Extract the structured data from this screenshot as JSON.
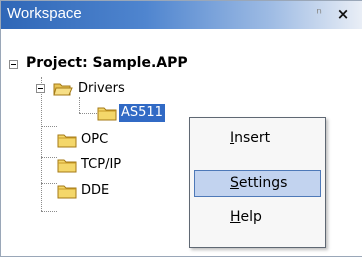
{
  "window": {
    "title": "Workspace",
    "pin_icon": "pin-icon",
    "close_icon": "close-icon",
    "title_color": "#2f67b7"
  },
  "tree": {
    "project_label": "Project: Sample.APP",
    "drivers_label": "Drivers",
    "driver_child_label": "AS511",
    "items": [
      "OPC",
      "TCP/IP",
      "DDE"
    ],
    "folder_color": "#f4d76a",
    "selection_color": "#316ac5"
  },
  "context_menu": {
    "items": [
      {
        "label": "Insert",
        "mnemonic": "I"
      },
      {
        "label": "Settings",
        "mnemonic": "S"
      },
      {
        "label": "Help",
        "mnemonic": "H"
      }
    ],
    "highlighted_item": "Settings"
  }
}
